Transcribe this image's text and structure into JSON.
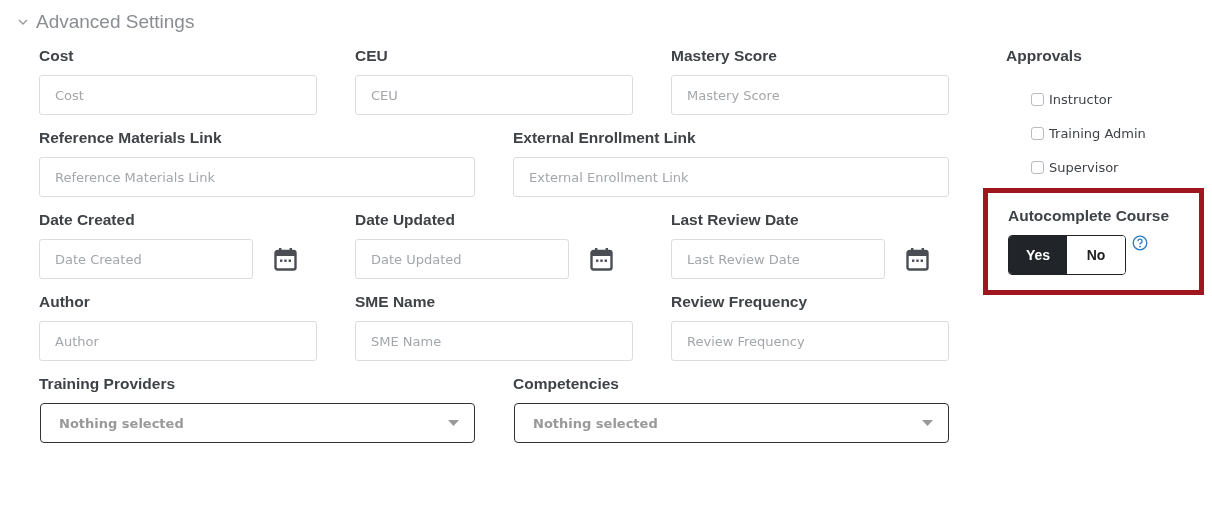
{
  "section": {
    "title": "Advanced Settings",
    "expanded": true
  },
  "rows": [
    [
      {
        "kind": "text",
        "label": "Cost",
        "placeholder": "Cost"
      },
      {
        "kind": "text",
        "label": "CEU",
        "placeholder": "CEU"
      },
      {
        "kind": "text",
        "label": "Mastery Score",
        "placeholder": "Mastery Score"
      }
    ],
    [
      {
        "kind": "text",
        "label": "Reference Materials Link",
        "placeholder": "Reference Materials Link"
      },
      {
        "kind": "text",
        "label": "External Enrollment Link",
        "placeholder": "External Enrollment Link"
      }
    ],
    [
      {
        "kind": "date",
        "label": "Date Created",
        "placeholder": "Date Created"
      },
      {
        "kind": "date",
        "label": "Date Updated",
        "placeholder": "Date Updated"
      },
      {
        "kind": "date",
        "label": "Last Review Date",
        "placeholder": "Last Review Date"
      }
    ],
    [
      {
        "kind": "text",
        "label": "Author",
        "placeholder": "Author"
      },
      {
        "kind": "text",
        "label": "SME Name",
        "placeholder": "SME Name"
      },
      {
        "kind": "text",
        "label": "Review Frequency",
        "placeholder": "Review Frequency"
      }
    ],
    [
      {
        "kind": "select",
        "label": "Training Providers",
        "value": "Nothing selected"
      },
      {
        "kind": "select",
        "label": "Competencies",
        "value": "Nothing selected"
      }
    ]
  ],
  "approvals": {
    "title": "Approvals",
    "items": [
      {
        "label": "Instructor",
        "checked": false
      },
      {
        "label": "Training Admin",
        "checked": false
      },
      {
        "label": "Supervisor",
        "checked": false
      }
    ]
  },
  "autocomplete": {
    "label": "Autocomplete Course",
    "highlighted": true,
    "options": [
      {
        "label": "Yes",
        "selected": true
      },
      {
        "label": "No",
        "selected": false
      }
    ]
  }
}
